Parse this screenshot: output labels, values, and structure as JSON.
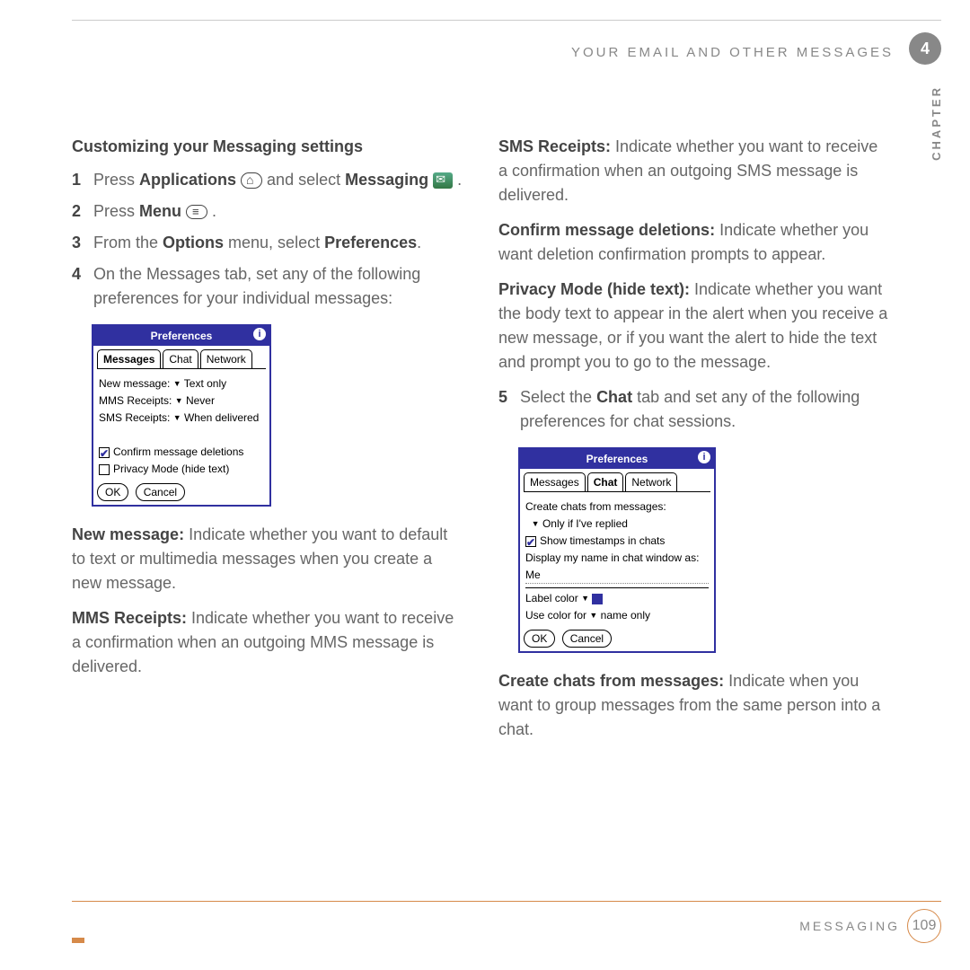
{
  "header": {
    "running_head": "YOUR EMAIL AND OTHER MESSAGES",
    "chapter_number": "4",
    "chapter_label": "CHAPTER"
  },
  "left": {
    "title": "Customizing your Messaging settings",
    "steps": [
      {
        "n": "1",
        "pre": "Press ",
        "bold1": "Applications",
        "mid": " ",
        "icon1": "home",
        "post1": " and select ",
        "bold2": "Messaging",
        "icon2": "msg",
        "post2": " ."
      },
      {
        "n": "2",
        "pre": "Press ",
        "bold1": "Menu",
        "mid": " ",
        "icon1": "menu",
        "post1": " ."
      },
      {
        "n": "3",
        "pre": "From the ",
        "bold1": "Options",
        "mid": " menu, select ",
        "bold2": "Preferences",
        "post2": "."
      },
      {
        "n": "4",
        "text": "On the Messages tab, set any of the following preferences for your individual messages:"
      }
    ],
    "prefs1": {
      "title": "Preferences",
      "tabs": [
        "Messages",
        "Chat",
        "Network"
      ],
      "active_tab": 0,
      "rows": [
        {
          "label": "New message:",
          "value": "Text only"
        },
        {
          "label": "MMS Receipts:",
          "value": "Never"
        },
        {
          "label": "SMS Receipts:",
          "value": "When delivered"
        }
      ],
      "checks": [
        {
          "checked": true,
          "label": "Confirm message deletions"
        },
        {
          "checked": false,
          "label": "Privacy Mode (hide text)"
        }
      ],
      "buttons": [
        "OK",
        "Cancel"
      ]
    },
    "defs": [
      {
        "term": "New message:",
        "body": " Indicate whether you want to default to text or multimedia messages when you create a new message."
      },
      {
        "term": "MMS Receipts:",
        "body": " Indicate whether you want to receive a confirmation when an outgoing MMS message is delivered."
      }
    ]
  },
  "right": {
    "defs_top": [
      {
        "term": "SMS Receipts:",
        "body": " Indicate whether you want to receive a confirmation when an outgoing SMS message is delivered."
      },
      {
        "term": "Confirm message deletions:",
        "body": " Indicate whether you want deletion confirmation prompts to appear."
      },
      {
        "term": "Privacy Mode (hide text):",
        "body": " Indicate whether you want the body text to appear in the alert when you receive a new message, or if you want the alert to hide the text and prompt you to go to the message."
      }
    ],
    "step5": {
      "n": "5",
      "pre": "Select the ",
      "bold": "Chat",
      "post": " tab and set any of the following preferences for chat sessions."
    },
    "prefs2": {
      "title": "Preferences",
      "tabs": [
        "Messages",
        "Chat",
        "Network"
      ],
      "active_tab": 1,
      "l1": "Create chats from messages:",
      "l1v": "Only if I've replied",
      "chk1": "Show timestamps in chats",
      "l2": "Display my name in chat window as:",
      "l2v": "Me",
      "l3": "Label color",
      "l4a": "Use color for",
      "l4b": "name only",
      "buttons": [
        "OK",
        "Cancel"
      ]
    },
    "defs_bottom": [
      {
        "term": "Create chats from messages:",
        "body": " Indicate when you want to group messages from the same person into a chat."
      }
    ]
  },
  "footer": {
    "section": "MESSAGING",
    "page": "109"
  }
}
